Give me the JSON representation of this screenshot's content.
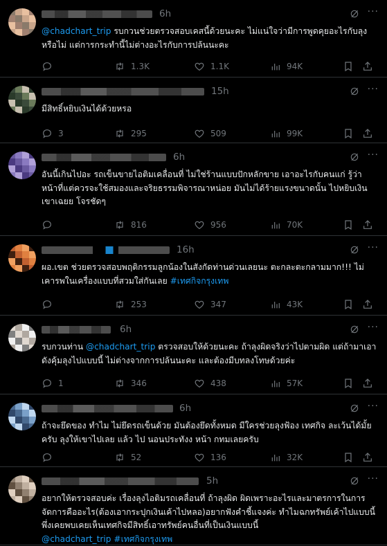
{
  "colors": {
    "background": "#000000",
    "text": "#e7e9ea",
    "muted": "#71767b",
    "link": "#1d9bf0",
    "divider": "#2f3336"
  },
  "posts": [
    {
      "time": "6h",
      "segments": [
        {
          "t": "@chadchart_trip",
          "link": true
        },
        {
          "t": " รบกวนช่วยตรวจสอบเคสนี้ด้วยนะคะ ไม่แน่ใจว่ามีการพูดคุยอะไรกับลุงหรือไม่ แต่การกระทำนี้ไม่ต่างอะไรกับการปล้นนะคะ",
          "link": false
        }
      ],
      "replies": "",
      "reposts": "1.3K",
      "likes": "1.1K",
      "views": "94K"
    },
    {
      "time": "15h",
      "segments": [
        {
          "t": "มีสิทธิ์หยิบเงินได้ด้วยหรอ",
          "link": false
        }
      ],
      "replies": "3",
      "reposts": "295",
      "likes": "509",
      "views": "99K"
    },
    {
      "time": "6h",
      "segments": [
        {
          "t": "อันนี้เกินไปอะ รถเข็นขายไอติมเคลื่อนที่ ไม่ใช่ร้านแบบปักหลักขาย เอาอะไรกับคนแก่ รู้ว่าหน้าที่แต่ควรจะใช้สมองและจริยธรรมพิจารณาหน่อย มันไม่ได้ร้ายแรงขนาดนั้น ไปหยิบเงินเขาเฉยย โจรชัดๆ",
          "link": false
        }
      ],
      "replies": "",
      "reposts": "816",
      "likes": "956",
      "views": "70K"
    },
    {
      "time": "16h",
      "segments": [
        {
          "t": "ผอ.เขต ช่วยตรวจสอบพฤติกรรมลูกน้องในสังกัดท่านด่วนเลยนะ ตะกละตะกลามมาก!!! ไม่เคารพในเครื่องแบบที่สวมใส่กันเลย ",
          "link": false
        },
        {
          "t": "#เทศกิจกรุงเทพ",
          "link": true
        }
      ],
      "replies": "",
      "reposts": "253",
      "likes": "347",
      "views": "43K"
    },
    {
      "time": "6h",
      "segments": [
        {
          "t": "รบกวนท่าน ",
          "link": false
        },
        {
          "t": "@chadchart_trip",
          "link": true
        },
        {
          "t": " ตรวจสอบให้ด้วยนะคะ ถ้าลุงผิดจริงว่าไปตามผิด แต่ถ้ามาเอาดังคุ้มลุงไปแบบนี้ ไม่ต่างจากการปล้นนะคะ และต้องมีบทลงโทษด้วยค่ะ",
          "link": false
        }
      ],
      "replies": "1",
      "reposts": "346",
      "likes": "438",
      "views": "57K"
    },
    {
      "time": "6h",
      "segments": [
        {
          "t": "ถ้าจะยึดของ ทำไม ไม่ยึดรถเข็นด้วย มันต้องยึดทั้งหมด มีใครช่วยลุงฟ้อง เทศกิจ ละเว้นได้มั้ยครับ ลุงให้เขาไปเลย แล้ว ไป นอนประทังง หน้า กทมเลยครับ",
          "link": false
        }
      ],
      "replies": "",
      "reposts": "52",
      "likes": "136",
      "views": "32K"
    },
    {
      "time": "5h",
      "segments": [
        {
          "t": "อยากให้ตรวจสอบค่ะ เรื่องลุงไอติมรถเคลื่อนที่ ถ้าลุงผิด ผิดเพราะอะไรและมาตรการในการจัดการคืออะไร(ต้องเอากระปุกเงินเค้าไปหลอ)อยากฟังคำชี้แจงค่ะ ทำไมฉกทรัพย์เค้าไปแบบนี้ พึ่งเคยพบเคยเห็นเทศกิจมีสิทธิ์เอาทรัพย์คนอื่นที่เป็นเงินแบบนี้\n",
          "link": false
        },
        {
          "t": "@chadchart_trip",
          "link": true
        },
        {
          "t": " ",
          "link": false
        },
        {
          "t": "#เทศกิจกรุงเทพ",
          "link": true
        }
      ],
      "replies": "",
      "reposts": "",
      "likes": "",
      "views": ""
    }
  ]
}
